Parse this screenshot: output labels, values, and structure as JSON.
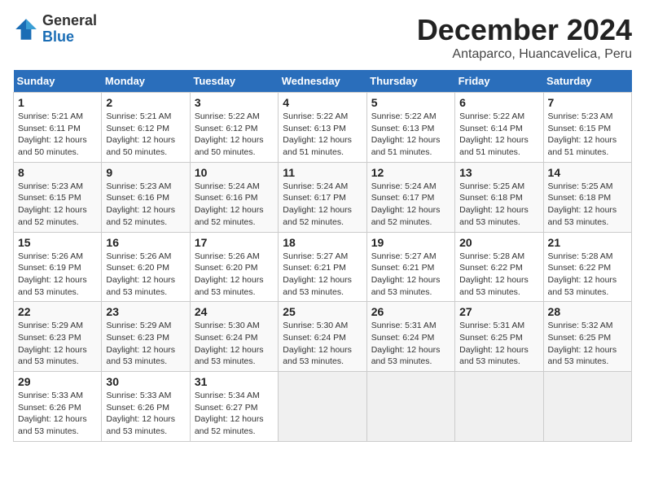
{
  "header": {
    "logo_general": "General",
    "logo_blue": "Blue",
    "month_title": "December 2024",
    "location": "Antaparco, Huancavelica, Peru"
  },
  "columns": [
    "Sunday",
    "Monday",
    "Tuesday",
    "Wednesday",
    "Thursday",
    "Friday",
    "Saturday"
  ],
  "rows": [
    [
      {
        "day": "1",
        "sunrise": "5:21 AM",
        "sunset": "6:11 PM",
        "daylight": "12 hours and 50 minutes."
      },
      {
        "day": "2",
        "sunrise": "5:21 AM",
        "sunset": "6:12 PM",
        "daylight": "12 hours and 50 minutes."
      },
      {
        "day": "3",
        "sunrise": "5:22 AM",
        "sunset": "6:12 PM",
        "daylight": "12 hours and 50 minutes."
      },
      {
        "day": "4",
        "sunrise": "5:22 AM",
        "sunset": "6:13 PM",
        "daylight": "12 hours and 51 minutes."
      },
      {
        "day": "5",
        "sunrise": "5:22 AM",
        "sunset": "6:13 PM",
        "daylight": "12 hours and 51 minutes."
      },
      {
        "day": "6",
        "sunrise": "5:22 AM",
        "sunset": "6:14 PM",
        "daylight": "12 hours and 51 minutes."
      },
      {
        "day": "7",
        "sunrise": "5:23 AM",
        "sunset": "6:15 PM",
        "daylight": "12 hours and 51 minutes."
      }
    ],
    [
      {
        "day": "8",
        "sunrise": "5:23 AM",
        "sunset": "6:15 PM",
        "daylight": "12 hours and 52 minutes."
      },
      {
        "day": "9",
        "sunrise": "5:23 AM",
        "sunset": "6:16 PM",
        "daylight": "12 hours and 52 minutes."
      },
      {
        "day": "10",
        "sunrise": "5:24 AM",
        "sunset": "6:16 PM",
        "daylight": "12 hours and 52 minutes."
      },
      {
        "day": "11",
        "sunrise": "5:24 AM",
        "sunset": "6:17 PM",
        "daylight": "12 hours and 52 minutes."
      },
      {
        "day": "12",
        "sunrise": "5:24 AM",
        "sunset": "6:17 PM",
        "daylight": "12 hours and 52 minutes."
      },
      {
        "day": "13",
        "sunrise": "5:25 AM",
        "sunset": "6:18 PM",
        "daylight": "12 hours and 53 minutes."
      },
      {
        "day": "14",
        "sunrise": "5:25 AM",
        "sunset": "6:18 PM",
        "daylight": "12 hours and 53 minutes."
      }
    ],
    [
      {
        "day": "15",
        "sunrise": "5:26 AM",
        "sunset": "6:19 PM",
        "daylight": "12 hours and 53 minutes."
      },
      {
        "day": "16",
        "sunrise": "5:26 AM",
        "sunset": "6:20 PM",
        "daylight": "12 hours and 53 minutes."
      },
      {
        "day": "17",
        "sunrise": "5:26 AM",
        "sunset": "6:20 PM",
        "daylight": "12 hours and 53 minutes."
      },
      {
        "day": "18",
        "sunrise": "5:27 AM",
        "sunset": "6:21 PM",
        "daylight": "12 hours and 53 minutes."
      },
      {
        "day": "19",
        "sunrise": "5:27 AM",
        "sunset": "6:21 PM",
        "daylight": "12 hours and 53 minutes."
      },
      {
        "day": "20",
        "sunrise": "5:28 AM",
        "sunset": "6:22 PM",
        "daylight": "12 hours and 53 minutes."
      },
      {
        "day": "21",
        "sunrise": "5:28 AM",
        "sunset": "6:22 PM",
        "daylight": "12 hours and 53 minutes."
      }
    ],
    [
      {
        "day": "22",
        "sunrise": "5:29 AM",
        "sunset": "6:23 PM",
        "daylight": "12 hours and 53 minutes."
      },
      {
        "day": "23",
        "sunrise": "5:29 AM",
        "sunset": "6:23 PM",
        "daylight": "12 hours and 53 minutes."
      },
      {
        "day": "24",
        "sunrise": "5:30 AM",
        "sunset": "6:24 PM",
        "daylight": "12 hours and 53 minutes."
      },
      {
        "day": "25",
        "sunrise": "5:30 AM",
        "sunset": "6:24 PM",
        "daylight": "12 hours and 53 minutes."
      },
      {
        "day": "26",
        "sunrise": "5:31 AM",
        "sunset": "6:24 PM",
        "daylight": "12 hours and 53 minutes."
      },
      {
        "day": "27",
        "sunrise": "5:31 AM",
        "sunset": "6:25 PM",
        "daylight": "12 hours and 53 minutes."
      },
      {
        "day": "28",
        "sunrise": "5:32 AM",
        "sunset": "6:25 PM",
        "daylight": "12 hours and 53 minutes."
      }
    ],
    [
      {
        "day": "29",
        "sunrise": "5:33 AM",
        "sunset": "6:26 PM",
        "daylight": "12 hours and 53 minutes."
      },
      {
        "day": "30",
        "sunrise": "5:33 AM",
        "sunset": "6:26 PM",
        "daylight": "12 hours and 53 minutes."
      },
      {
        "day": "31",
        "sunrise": "5:34 AM",
        "sunset": "6:27 PM",
        "daylight": "12 hours and 52 minutes."
      },
      null,
      null,
      null,
      null
    ]
  ],
  "labels": {
    "sunrise": "Sunrise:",
    "sunset": "Sunset:",
    "daylight": "Daylight:"
  }
}
